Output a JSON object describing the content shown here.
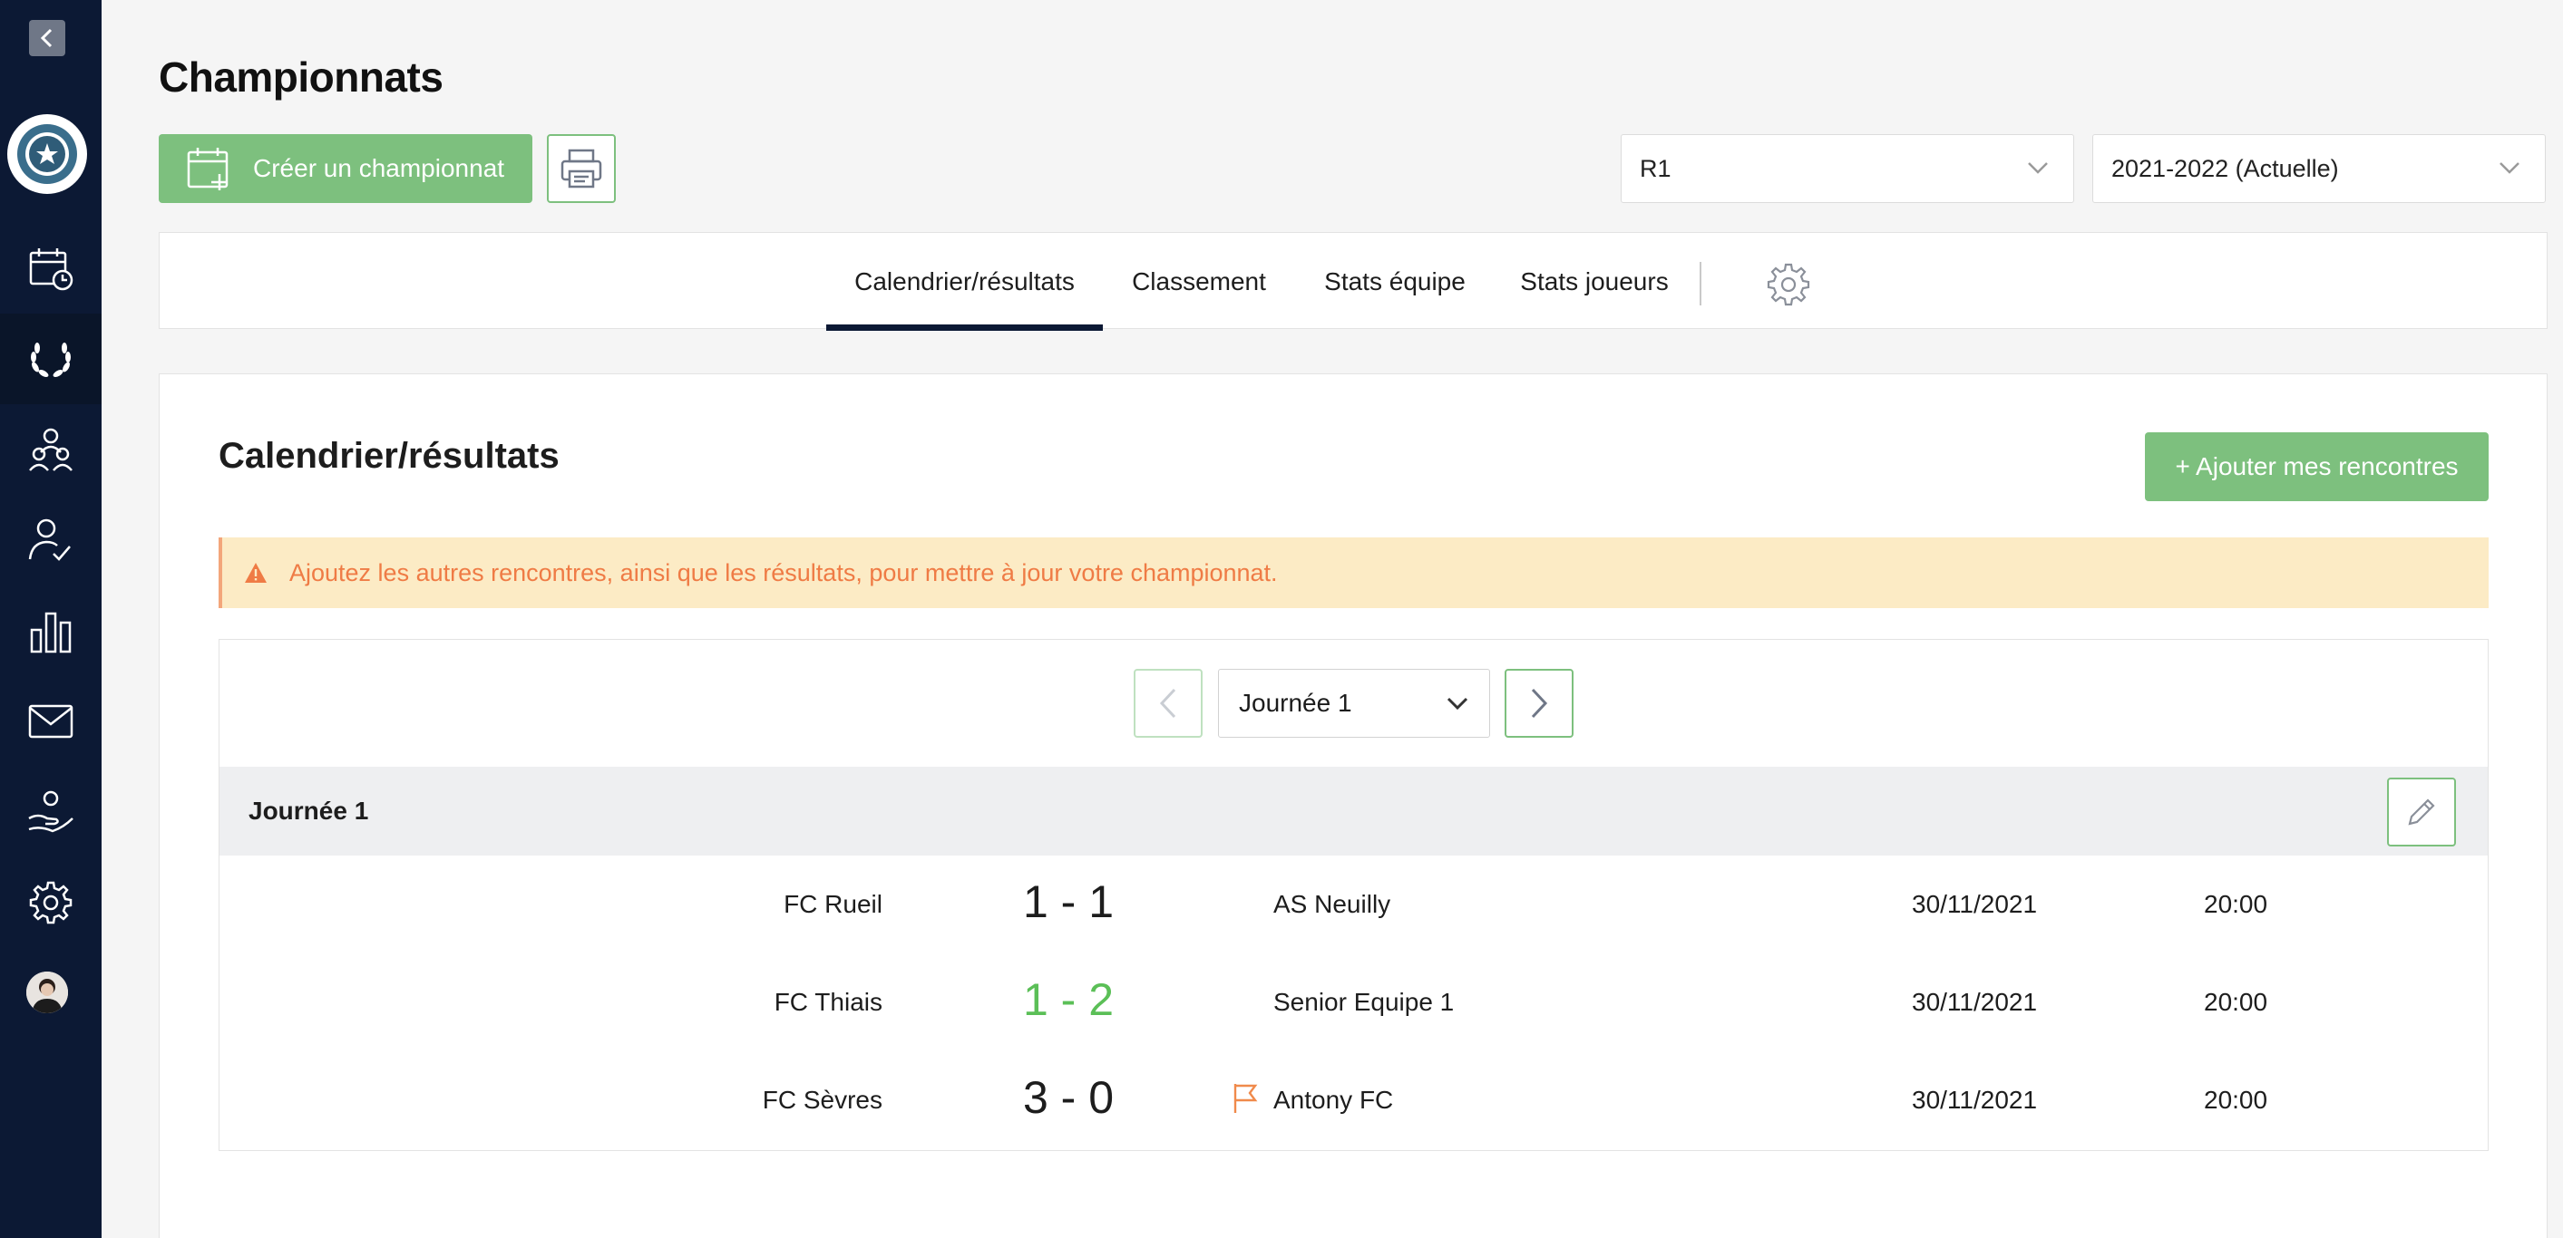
{
  "sidebar": {
    "back_icon": "chevron-left-icon",
    "items": [
      {
        "name": "calendar-clock",
        "icon": "calendar-clock-icon",
        "active": false
      },
      {
        "name": "championships",
        "icon": "laurel-icon",
        "active": true
      },
      {
        "name": "team",
        "icon": "users-icon",
        "active": false
      },
      {
        "name": "attendance",
        "icon": "user-check-icon",
        "active": false
      },
      {
        "name": "stats",
        "icon": "bar-chart-icon",
        "active": false
      },
      {
        "name": "messages",
        "icon": "mail-icon",
        "active": false
      },
      {
        "name": "sponsors",
        "icon": "hand-heart-icon",
        "active": false
      },
      {
        "name": "settings",
        "icon": "gear-icon",
        "active": false
      }
    ]
  },
  "header": {
    "title": "Championnats",
    "create_label": "Créer un championnat",
    "division_value": "R1",
    "season_value": "2021-2022 (Actuelle)"
  },
  "tabs": [
    {
      "label": "Calendrier/résultats",
      "active": true
    },
    {
      "label": "Classement",
      "active": false
    },
    {
      "label": "Stats équipe",
      "active": false
    },
    {
      "label": "Stats joueurs",
      "active": false
    }
  ],
  "main": {
    "section_title": "Calendrier/résultats",
    "add_matches_label": "+ Ajouter mes rencontres",
    "alert_text": "Ajoutez les autres rencontres, ainsi que les résultats, pour mettre à jour votre championnat.",
    "round_select_value": "Journée 1",
    "round_header": "Journée 1",
    "matches": [
      {
        "home": "FC Rueil",
        "score": "1 - 1",
        "away": "AS Neuilly",
        "date": "30/11/2021",
        "time": "20:00",
        "highlight": false,
        "flag": false
      },
      {
        "home": "FC Thiais",
        "score": "1 - 2",
        "away": "Senior Equipe 1",
        "date": "30/11/2021",
        "time": "20:00",
        "highlight": true,
        "flag": false
      },
      {
        "home": "FC Sèvres",
        "score": "3 - 0",
        "away": "Antony FC",
        "date": "30/11/2021",
        "time": "20:00",
        "highlight": false,
        "flag": true
      }
    ]
  },
  "colors": {
    "sidebar_bg": "#0c1934",
    "green": "#7dc07e",
    "alert_bg": "#fcebc5",
    "alert_text": "#ef7b45",
    "win_score": "#5bbf57"
  }
}
